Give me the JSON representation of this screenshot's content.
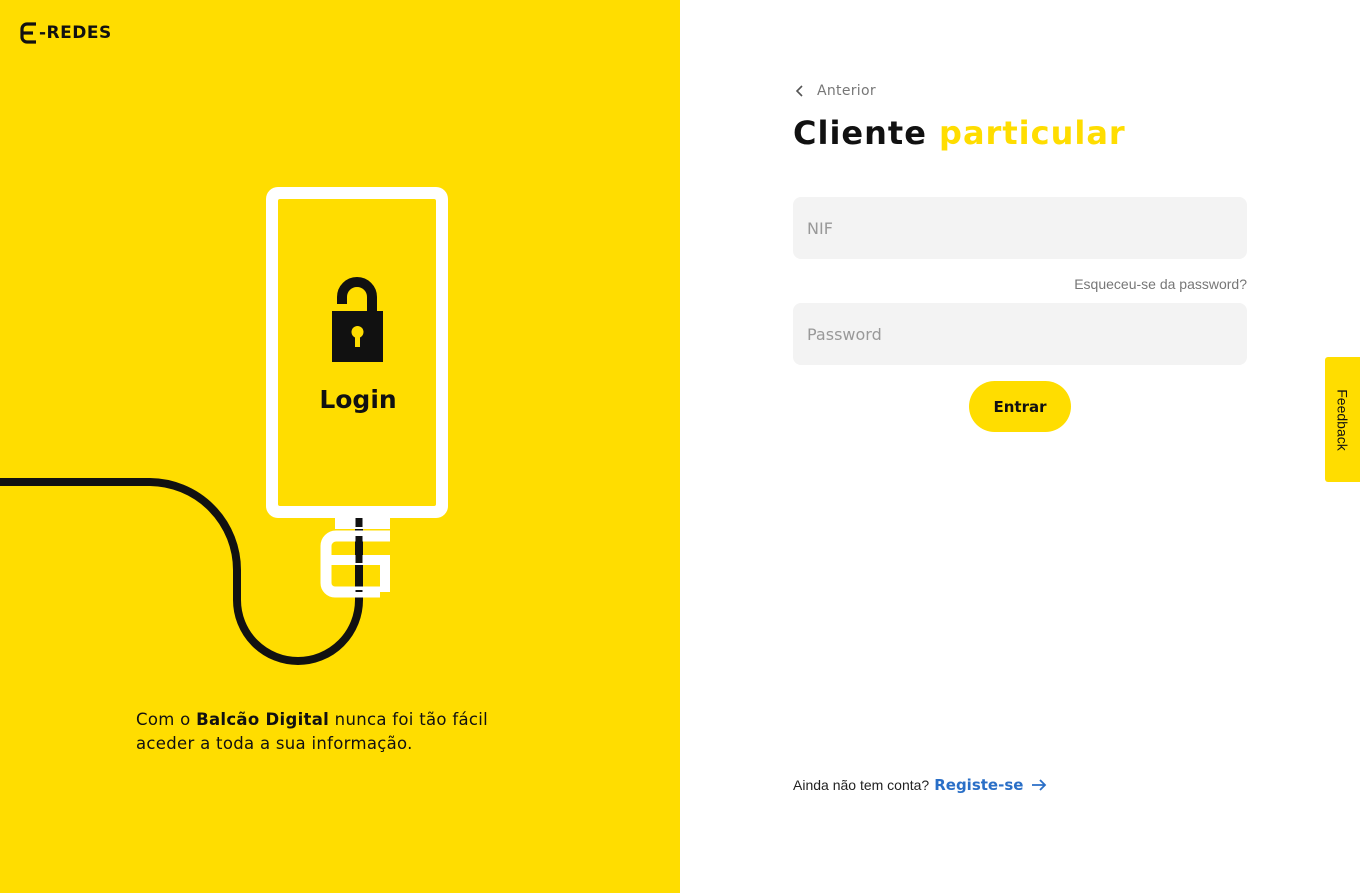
{
  "brand": {
    "name": "E-REDES",
    "logo_text": "-REDES",
    "accent_color": "#ffdd00",
    "link_color": "#2a6fc7"
  },
  "hero": {
    "phone_label": "Login",
    "tagline_pre": "Com o ",
    "tagline_bold": "Balcão Digital",
    "tagline_post": " nunca foi tão fácil aceder a toda a sua informação."
  },
  "nav": {
    "back_label": "Anterior"
  },
  "form": {
    "title_main": "Cliente ",
    "title_accent": "particular",
    "nif_placeholder": "NIF",
    "nif_value": "",
    "forgot_label": "Esqueceu-se da password?",
    "password_placeholder": "Password",
    "password_value": "",
    "submit_label": "Entrar"
  },
  "register": {
    "prompt": "Ainda não tem conta?",
    "link_label": "Registe-se"
  },
  "feedback": {
    "label": "Feedback"
  },
  "icons": {
    "back": "chevron-left-icon",
    "lock": "lock-icon",
    "register_arrow": "arrow-right-icon",
    "logo": "eredes-logo-icon"
  }
}
